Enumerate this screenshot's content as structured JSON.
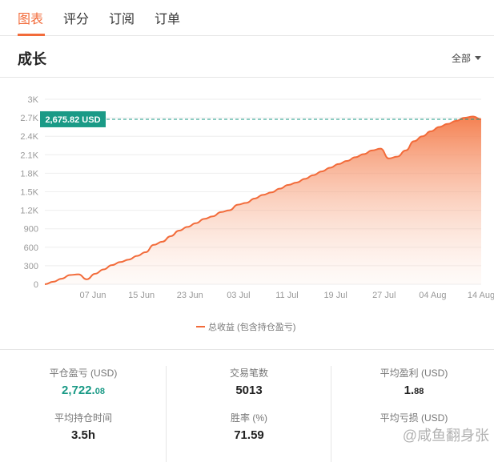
{
  "tabs": [
    {
      "label": "图表"
    },
    {
      "label": "评分"
    },
    {
      "label": "订阅"
    },
    {
      "label": "订单"
    }
  ],
  "section": {
    "title": "成长",
    "filter_label": "全部"
  },
  "chart_data": {
    "type": "area",
    "x_tick_labels": [
      "07 Jun",
      "15 Jun",
      "23 Jun",
      "03 Jul",
      "11 Jul",
      "19 Jul",
      "27 Jul",
      "04 Aug",
      "14 Aug"
    ],
    "y_tick_labels": [
      "0",
      "300",
      "600",
      "900",
      "1.2K",
      "1.5K",
      "1.8K",
      "2.1K",
      "2.4K",
      "2.7K",
      "3K"
    ],
    "y_ticks": [
      0,
      300,
      600,
      900,
      1200,
      1500,
      1800,
      2100,
      2400,
      2700,
      3000
    ],
    "ylim": [
      0,
      3000
    ],
    "series": [
      {
        "name": "总收益 (包含持仓盈亏)",
        "color": "#f26b3a",
        "values": [
          0,
          40,
          90,
          150,
          160,
          80,
          170,
          240,
          310,
          360,
          400,
          460,
          520,
          640,
          690,
          780,
          870,
          930,
          990,
          1060,
          1100,
          1170,
          1200,
          1290,
          1320,
          1390,
          1450,
          1490,
          1550,
          1610,
          1650,
          1710,
          1770,
          1830,
          1890,
          1950,
          2000,
          2060,
          2110,
          2170,
          2200,
          2040,
          2070,
          2170,
          2320,
          2400,
          2480,
          2550,
          2600,
          2650,
          2700,
          2720,
          2676
        ]
      }
    ],
    "highlight": {
      "value": 2675.82,
      "label": "2,675.82 USD",
      "color": "#1a9a86"
    },
    "grid": true,
    "legend_position": "bottom"
  },
  "stats": {
    "col1": [
      {
        "label": "平仓盈亏 (USD)",
        "value_main": "2,722.",
        "value_small": "08",
        "color": "green"
      },
      {
        "label": "平均持仓时间",
        "value_main": "3.5h",
        "value_small": ""
      }
    ],
    "col2": [
      {
        "label": "交易笔数",
        "value_main": "5013",
        "value_small": ""
      },
      {
        "label": "胜率 (%)",
        "value_main": "71.59",
        "value_small": ""
      }
    ],
    "col3": [
      {
        "label": "平均盈利 (USD)",
        "value_main": "1.",
        "value_small": "88"
      },
      {
        "label": "平均亏损 (USD)",
        "value_main": "",
        "value_small": ""
      }
    ]
  },
  "watermark": "@咸鱼翻身张"
}
